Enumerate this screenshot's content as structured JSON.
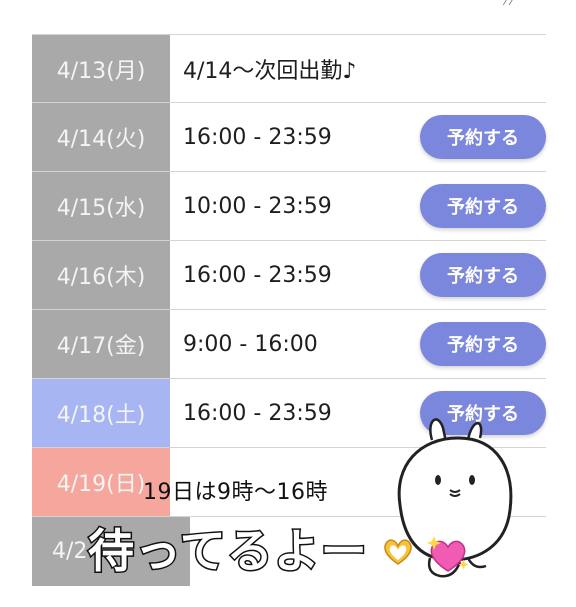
{
  "schedule": {
    "rows": [
      {
        "date": "4/13(月)",
        "time": "4/14〜次回出勤♪",
        "button": "",
        "day_type": "weekday"
      },
      {
        "date": "4/14(火)",
        "time": "16:00 - 23:59",
        "button": "予約する",
        "day_type": "weekday"
      },
      {
        "date": "4/15(水)",
        "time": "10:00 - 23:59",
        "button": "予約する",
        "day_type": "weekday"
      },
      {
        "date": "4/16(木)",
        "time": "16:00 - 23:59",
        "button": "予約する",
        "day_type": "weekday"
      },
      {
        "date": "4/17(金)",
        "time": "9:00 - 16:00",
        "button": "予約する",
        "day_type": "weekday"
      },
      {
        "date": "4/18(土)",
        "time": "16:00 - 23:59",
        "button": "予約する",
        "day_type": "saturday"
      },
      {
        "date": "4/19(日)",
        "time": "",
        "button": "",
        "day_type": "sunday"
      },
      {
        "date": "4/2",
        "time": "",
        "button": "",
        "day_type": "weekday"
      }
    ]
  },
  "overlay": {
    "caption": "19日は9時〜16時",
    "stamp_text": "待ってるよー"
  },
  "colors": {
    "weekday_cell": "#a9a9a9",
    "saturday_cell": "#a7b5f3",
    "sunday_cell": "#f6a79d",
    "button": "#7b86dd"
  }
}
